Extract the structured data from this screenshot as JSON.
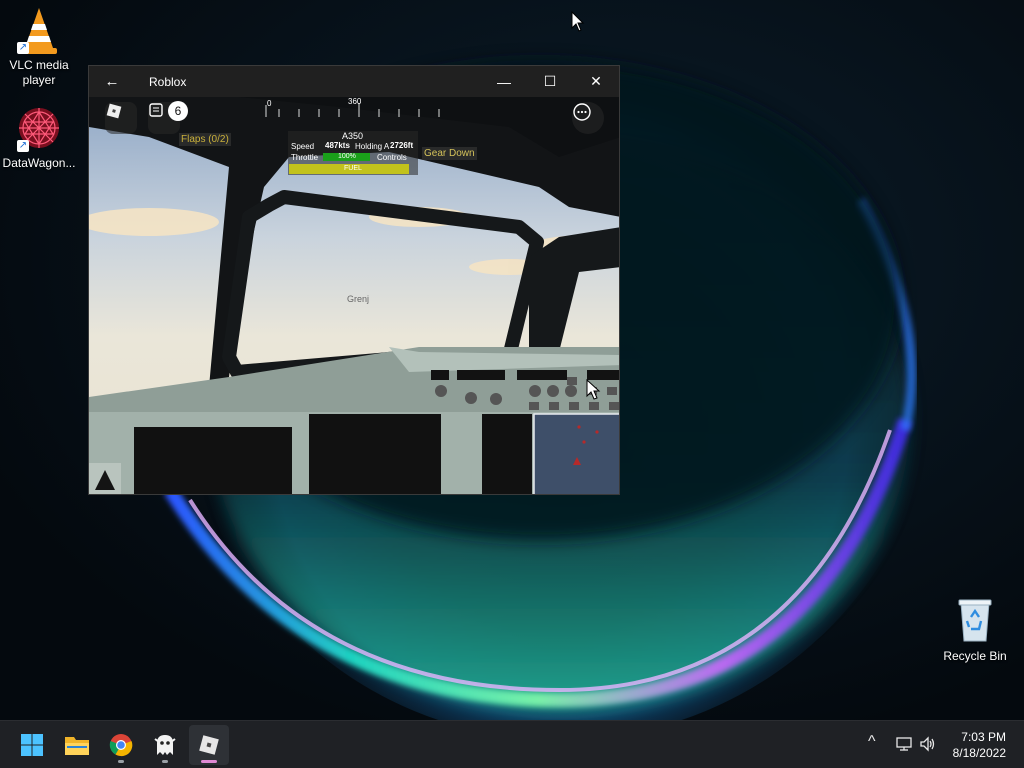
{
  "desktop": {
    "icons": [
      {
        "label": "VLC media player"
      },
      {
        "label": "DataWagon..."
      },
      {
        "label": "Recycle Bin"
      }
    ]
  },
  "window": {
    "title": "Roblox",
    "back_icon": "back-arrow-icon",
    "minimize_glyph": "—",
    "maximize_glyph": "☐",
    "close_glyph": "✕"
  },
  "game": {
    "chat_badge": "6",
    "flaps_label": "Flaps (0/2)",
    "aircraft": "A350",
    "speed_label": "Speed",
    "speed_value": "487kts",
    "holding_label": "Holding A",
    "altitude_value": "2726ft",
    "throttle_label": "Throttle",
    "throttle_value": "100%",
    "controls_label": "Controls",
    "fuel_label": "FUEL",
    "gear_label": "Gear Down",
    "player_name": "Grenj",
    "heading_left": "0",
    "heading_center": "360",
    "throttle_fill": 1.0,
    "fuel_fill": 1.0
  },
  "taskbar": {
    "apps": [
      "start-icon",
      "file-explorer-icon",
      "chrome-icon",
      "ghost-app-icon",
      "roblox-icon"
    ],
    "tray_chevron": "^",
    "time": "7:03 PM",
    "date": "8/18/2022"
  },
  "colors": {
    "accent": "#e08ad4",
    "gear_text": "#d4c25a",
    "fuel_bar": "#c2c21c",
    "throttle_bar": "#1aa01a"
  }
}
